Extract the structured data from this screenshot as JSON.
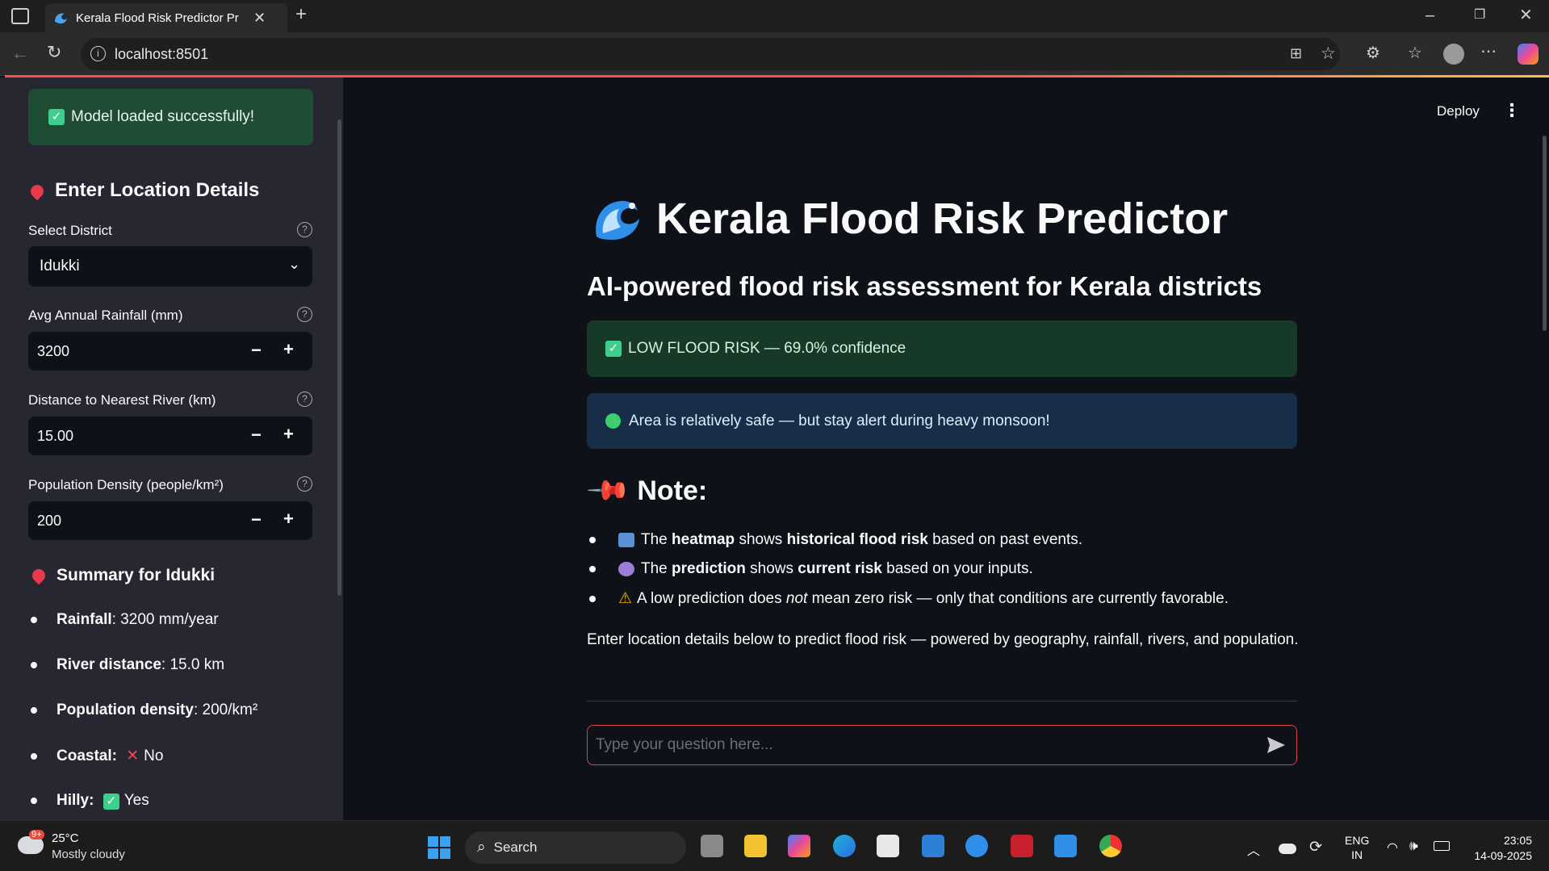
{
  "browser": {
    "tab_title": "Kerala Flood Risk Predictor Pr",
    "url": "localhost:8501"
  },
  "sidebar": {
    "success_message": "Model loaded successfully!",
    "location_heading": "Enter Location Details",
    "district_label": "Select District",
    "district_value": "Idukki",
    "rainfall_label": "Avg Annual Rainfall (mm)",
    "rainfall_value": "3200",
    "river_label": "Distance to Nearest River (km)",
    "river_value": "15.00",
    "population_label": "Population Density (people/km²)",
    "population_value": "200",
    "summary_heading": "Summary for Idukki",
    "summary": [
      {
        "key": "Rainfall",
        "value": ": 3200 mm/year"
      },
      {
        "key": "River distance",
        "value": ": 15.0 km"
      },
      {
        "key": "Population density",
        "value": ": 200/km²"
      },
      {
        "key": "Coastal",
        "value": ":",
        "extra": "No"
      },
      {
        "key": "Hilly",
        "value": ":",
        "extra": "Yes"
      }
    ]
  },
  "header": {
    "deploy_label": "Deploy"
  },
  "main": {
    "title": "Kerala Flood Risk Predictor",
    "subtitle": "AI-powered flood risk assessment for Kerala districts",
    "risk_message": "LOW FLOOD RISK — 69.0% confidence",
    "info_message": "Area is relatively safe — but stay alert during heavy monsoon!",
    "note_heading": "Note:",
    "notes": [
      {
        "t1": "The ",
        "b1": "heatmap",
        "t2": " shows ",
        "b2": "historical flood risk",
        "t3": " based on past events."
      },
      {
        "t1": "The ",
        "b1": "prediction",
        "t2": " shows ",
        "b2": "current risk",
        "t3": " based on your inputs."
      },
      {
        "t1": "A low prediction does ",
        "i1": "not",
        "t2": " mean zero risk — only that conditions are currently favorable."
      }
    ],
    "intro": "Enter location details below to predict flood risk — powered by geography, rainfall, rivers, and population.",
    "chat_placeholder": "Type your question here..."
  },
  "taskbar": {
    "weather_temp": "25°C",
    "weather_desc": "Mostly cloudy",
    "weather_badge": "9+",
    "search_label": "Search",
    "lang_line1": "ENG",
    "lang_line2": "IN",
    "time": "23:05",
    "date": "14-09-2025"
  },
  "colors": {
    "accent_red": "#ff4b4b",
    "success_bg": "#173928",
    "info_bg": "#172d48",
    "sidebar_bg": "#262730",
    "main_bg": "#0e1117"
  }
}
